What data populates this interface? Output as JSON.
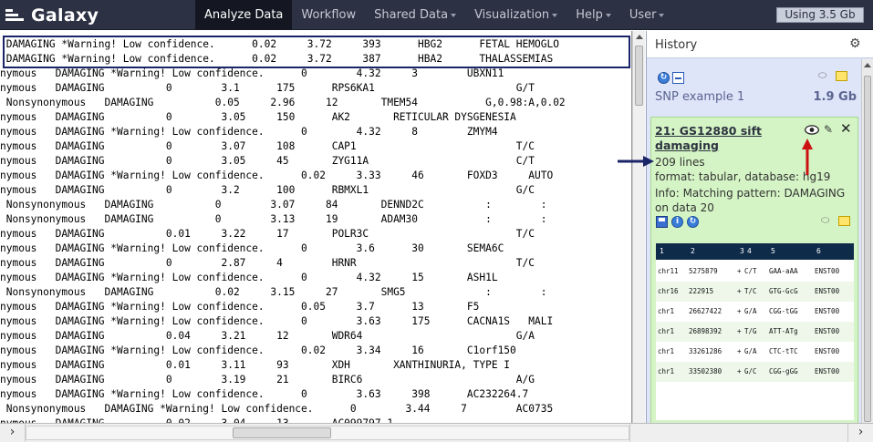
{
  "app": {
    "brand": "Galaxy",
    "nav": [
      {
        "label": "Analyze Data",
        "active": true,
        "dropdown": false
      },
      {
        "label": "Workflow",
        "active": false,
        "dropdown": false
      },
      {
        "label": "Shared Data",
        "active": false,
        "dropdown": true
      },
      {
        "label": "Visualization",
        "active": false,
        "dropdown": true
      },
      {
        "label": "Help",
        "active": false,
        "dropdown": true
      },
      {
        "label": "User",
        "active": false,
        "dropdown": true
      }
    ],
    "quota": "Using 3.5 Gb"
  },
  "center": {
    "lines": [
      " DAMAGING *Warning! Low confidence.      0.02     3.72     393      HBG2      FETAL HEMOGLO",
      " DAMAGING *Warning! Low confidence.      0.02     3.72     387      HBA2      THALASSEMIAS",
      "nymous   DAMAGING *Warning! Low confidence.      0        4.32     3        UBXN11",
      "nymous   DAMAGING          0        3.1      175      RPS6KA1                       G/T",
      " Nonsynonymous   DAMAGING          0.05     2.96     12       TMEM54           G,0.98:A,0.02",
      "nymous   DAMAGING          0        3.05     150      AK2       RETICULAR DYSGENESIA",
      "nymous   DAMAGING *Warning! Low confidence.      0        4.32     8        ZMYM4",
      "nymous   DAMAGING          0        3.07     108      CAP1                          T/C",
      "nymous   DAMAGING          0        3.05     45       ZYG11A                        C/T",
      "nymous   DAMAGING *Warning! Low confidence.      0.02     3.33     46       FOXD3     AUTO",
      "nymous   DAMAGING          0        3.2      100      RBMXL1                        G/C",
      " Nonsynonymous   DAMAGING          0        3.07     84       DENND2C          :        :",
      " Nonsynonymous   DAMAGING          0        3.13     19       ADAM30           :        :",
      "nymous   DAMAGING          0.01     3.22     17       POLR3C                        T/C",
      "nymous   DAMAGING *Warning! Low confidence.      0        3.6      30       SEMA6C",
      "nymous   DAMAGING          0        2.87     4        HRNR                          T/C",
      "nymous   DAMAGING *Warning! Low confidence.      0        4.32     15       ASH1L",
      " Nonsynonymous   DAMAGING          0.02     3.15     27       SMG5             :        :",
      "nymous   DAMAGING *Warning! Low confidence.      0.05     3.7      13       F5",
      "nymous   DAMAGING *Warning! Low confidence.      0        3.63     175      CACNA1S   MALI",
      "nymous   DAMAGING          0.04     3.21     12       WDR64                         G/A",
      "nymous   DAMAGING *Warning! Low confidence.      0.02     3.34     16       C1orf150",
      "nymous   DAMAGING          0.01     3.11     93       XDH       XANTHINURIA, TYPE I",
      "nymous   DAMAGING          0        3.19     21       BIRC6                         A/G",
      "nymous   DAMAGING *Warning! Low confidence.      0        3.63     398      AC232264.7",
      " Nonsynonymous   DAMAGING *Warning! Low confidence.      0        3.44     7        AC0735",
      "nymous   DAMAGING          0.02     3.04     13       AC099797.1"
    ]
  },
  "history": {
    "title": "History",
    "name": "SNP example 1",
    "size": "1.9 Gb",
    "dataset": {
      "title": "21: GS12880 sift damaging",
      "lines": "209 lines",
      "format": "format: tabular, database: hg19",
      "info": "Info: Matching pattern: DAMAGING on data 20",
      "peek_headers": [
        "1",
        "2",
        "3",
        "4",
        "5",
        "6"
      ],
      "peek_rows": [
        [
          "chr11",
          "5275879",
          "+",
          "C/T",
          "GAA-aAA",
          "ENST00"
        ],
        [
          "chr16",
          "222915",
          "+",
          "T/C",
          "GTG-GcG",
          "ENST00"
        ],
        [
          "chr1",
          "26627422",
          "+",
          "G/A",
          "CGG-tGG",
          "ENST00"
        ],
        [
          "chr1",
          "26898392",
          "+",
          "T/G",
          "ATT-ATg",
          "ENST00"
        ],
        [
          "chr1",
          "33261286",
          "+",
          "G/A",
          "CTC-tTC",
          "ENST00"
        ],
        [
          "chr1",
          "33502380",
          "+",
          "G/C",
          "CGG-gGG",
          "ENST00"
        ]
      ]
    }
  },
  "controls": {
    "left_collapse": "›",
    "right_collapse": "›"
  },
  "icons": {
    "gear": "gear-icon",
    "eye": "eye-icon",
    "pencil": "pencil-icon",
    "delete": "delete-icon"
  },
  "colors": {
    "masthead": "#2c3143",
    "dataset_ok": "#d4f4c5",
    "annotation_blue": "#1a2468",
    "annotation_red": "#cc1111"
  }
}
